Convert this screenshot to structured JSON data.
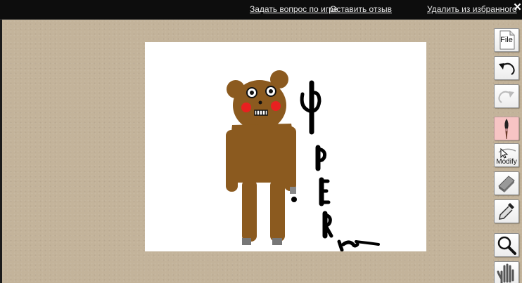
{
  "top_links": {
    "ask_question": "Задать вопрос по игре",
    "leave_review": "Оставить отзыв",
    "remove_favorite": "Удалить из избранного",
    "close_symbol": "✕"
  },
  "colors": {
    "topbar_bg": "#0d0d0d",
    "workspace_bg": "#c3b39a",
    "canvas_bg": "#ffffff",
    "bear_brown": "#8b5a1f",
    "cheek_red": "#e82020",
    "brush_active_bg": "#f7c4c4"
  },
  "toolbar": {
    "file_label": "File",
    "undo_icon": "undo-arrow-icon",
    "redo_icon": "redo-arrow-icon",
    "brush_icon": "brush-icon",
    "modify_label": "Modify",
    "eraser_icon": "eraser-icon",
    "eyedropper_icon": "eyedropper-icon",
    "zoom_icon": "magnifier-icon",
    "hand_icon": "hand-icon"
  },
  "canvas": {
    "drawing_description_icon": "bear-drawing"
  }
}
